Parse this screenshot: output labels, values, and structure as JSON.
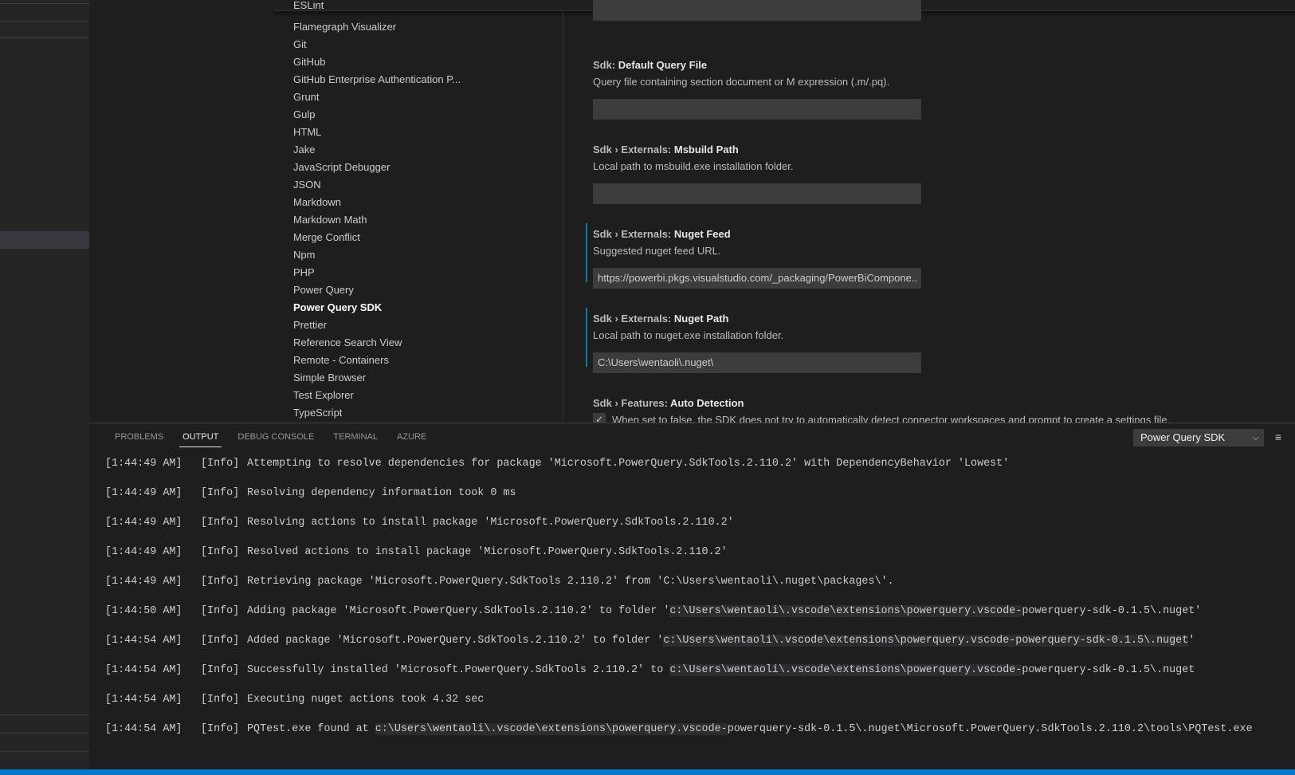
{
  "toc": {
    "items": [
      "ESLint",
      "Flamegraph Visualizer",
      "Git",
      "GitHub",
      "GitHub Enterprise Authentication P...",
      "Grunt",
      "Gulp",
      "HTML",
      "Jake",
      "JavaScript Debugger",
      "JSON",
      "Markdown",
      "Markdown Math",
      "Merge Conflict",
      "Npm",
      "PHP",
      "Power Query",
      "Power Query SDK",
      "Prettier",
      "Reference Search View",
      "Remote - Containers",
      "Simple Browser",
      "Test Explorer",
      "TypeScript"
    ],
    "active": "Power Query SDK"
  },
  "settings": [
    {
      "category": "",
      "name": "",
      "description": "",
      "value": ""
    },
    {
      "category": "Sdk: ",
      "name": "Default Query File",
      "description": "Query file containing section document or M expression (.m/.pq).",
      "value": ""
    },
    {
      "category": "Sdk › Externals: ",
      "name": "Msbuild Path",
      "description": "Local path to msbuild.exe installation folder.",
      "value": ""
    },
    {
      "category": "Sdk › Externals: ",
      "name": "Nuget Feed",
      "description": "Suggested nuget feed URL.",
      "value": "https://powerbi.pkgs.visualstudio.com/_packaging/PowerBiCompone..."
    },
    {
      "category": "Sdk › Externals: ",
      "name": "Nuget Path",
      "description": "Local path to nuget.exe installation folder.",
      "value": "C:\\Users\\wentaoli\\.nuget\\"
    },
    {
      "category": "Sdk › Features: ",
      "name": "Auto Detection",
      "description": "When set to false, the SDK does not try to automatically detect connector workspaces and prompt to create a settings file.",
      "checked": true
    }
  ],
  "panel": {
    "tabs": [
      "PROBLEMS",
      "OUTPUT",
      "DEBUG CONSOLE",
      "TERMINAL",
      "AZURE"
    ],
    "active_tab": "OUTPUT",
    "channel": "Power Query SDK"
  },
  "log": [
    {
      "time": "[1:44:49 AM]",
      "level": "[Info]",
      "pre": "Attempting to resolve dependencies for package 'Microsoft.PowerQuery.SdkTools.2.110.2' with DependencyBehavior 'Lowest'",
      "hl": "",
      "post": ""
    },
    {
      "time": "[1:44:49 AM]",
      "level": "[Info]",
      "pre": "Resolving dependency information took 0 ms",
      "hl": "",
      "post": ""
    },
    {
      "time": "[1:44:49 AM]",
      "level": "[Info]",
      "pre": "Resolving actions to install package 'Microsoft.PowerQuery.SdkTools.2.110.2'",
      "hl": "",
      "post": ""
    },
    {
      "time": "[1:44:49 AM]",
      "level": "[Info]",
      "pre": "Resolved actions to install package 'Microsoft.PowerQuery.SdkTools.2.110.2'",
      "hl": "",
      "post": ""
    },
    {
      "time": "[1:44:49 AM]",
      "level": "[Info]",
      "pre": "Retrieving package 'Microsoft.PowerQuery.SdkTools 2.110.2' from 'C:\\Users\\wentaoli\\.nuget\\packages\\'.",
      "hl": "",
      "post": ""
    },
    {
      "time": "[1:44:50 AM]",
      "level": "[Info]",
      "pre": "Adding package 'Microsoft.PowerQuery.SdkTools.2.110.2' to folder '",
      "hl": "c:\\Users\\wentaoli\\.vscode\\extensions\\powerquery.vscode-",
      "post": "powerquery-sdk-0.1.5\\.nuget'"
    },
    {
      "time": "[1:44:54 AM]",
      "level": "[Info]",
      "pre": "Added package 'Microsoft.PowerQuery.SdkTools.2.110.2' to folder '",
      "hl": "c:\\Users\\wentaoli\\.vscode\\extensions\\powerquery.vscode-powerquery-sdk-0.1.5\\.nuget",
      "post": "'"
    },
    {
      "time": "[1:44:54 AM]",
      "level": "[Info]",
      "pre": "Successfully installed 'Microsoft.PowerQuery.SdkTools 2.110.2' to ",
      "hl": "c:\\Users\\wentaoli\\.vscode\\extensions\\powerquery.vscode-",
      "post": "powerquery-sdk-0.1.5\\.nuget"
    },
    {
      "time": "[1:44:54 AM]",
      "level": "[Info]",
      "pre": "Executing nuget actions took 4.32 sec",
      "hl": "",
      "post": ""
    },
    {
      "time": "[1:44:54 AM]",
      "level": "[Info]",
      "pre": "PQTest.exe found at ",
      "hl": "c:\\Users\\wentaoli\\.vscode\\extensions\\powerquery.vscode-",
      "post": "powerquery-sdk-0.1.5\\.nuget\\Microsoft.PowerQuery.SdkTools.2.110.2\\tools\\PQTest.exe"
    }
  ]
}
